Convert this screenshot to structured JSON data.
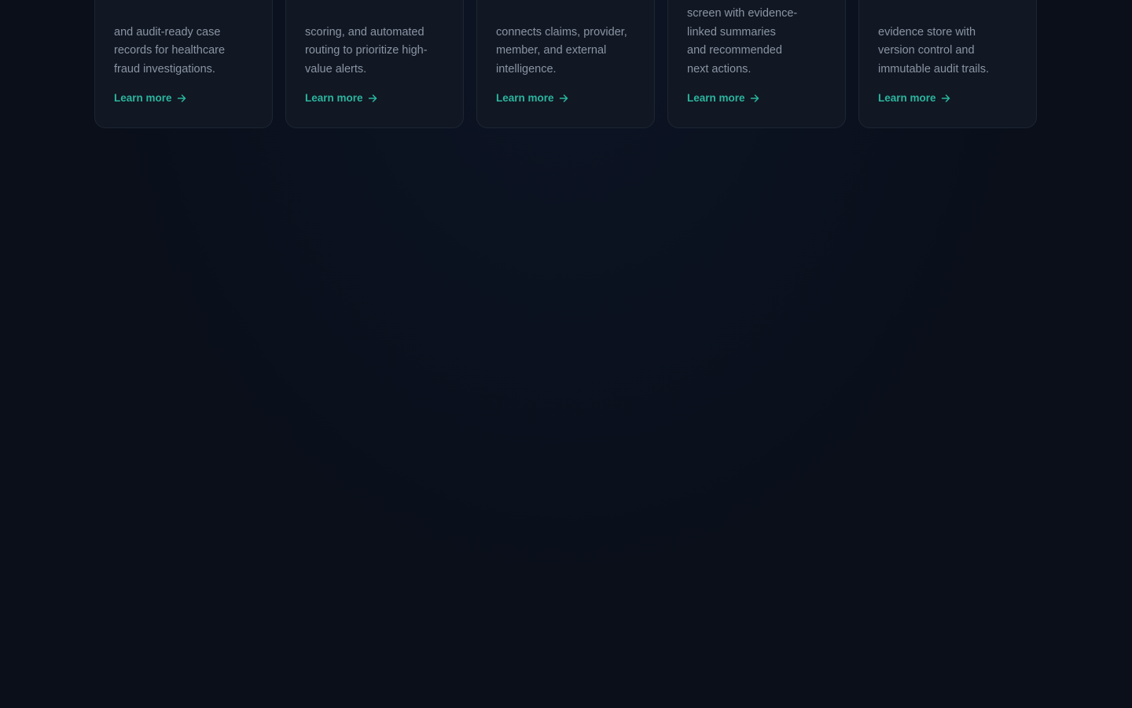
{
  "cards": [
    {
      "desc": "and audit-ready case records for healthcare fraud investigations.",
      "lines": [
        "and audit-ready case",
        "records for healthcare",
        "fraud investigations."
      ],
      "link_label": "Learn more"
    },
    {
      "desc": "scoring, and automated routing to prioritize high-value alerts.",
      "lines": [
        "scoring, and automated",
        "routing to prioritize high-",
        "value alerts."
      ],
      "link_label": "Learn more"
    },
    {
      "desc": "connects claims, provider, member, and external intelligence.",
      "lines": [
        "connects claims, provider,",
        "member, and external",
        "intelligence."
      ],
      "link_label": "Learn more"
    },
    {
      "desc": "screen with evidence-linked summaries and recommended next actions.",
      "lines": [
        "screen with evidence-",
        "linked summaries",
        "and recommended",
        "next actions."
      ],
      "link_label": "Learn more"
    },
    {
      "desc": "evidence store with version control and immutable audit trails.",
      "lines": [
        "evidence store with",
        "version control and",
        "immutable audit trails."
      ],
      "link_label": "Learn more"
    }
  ],
  "colors": {
    "background": "#0a0f1a",
    "card": "#111723",
    "accent": "#2bb59e",
    "muted_text": "#8a94a3"
  },
  "icons": {
    "link_arrow": "arrow-right-icon"
  }
}
